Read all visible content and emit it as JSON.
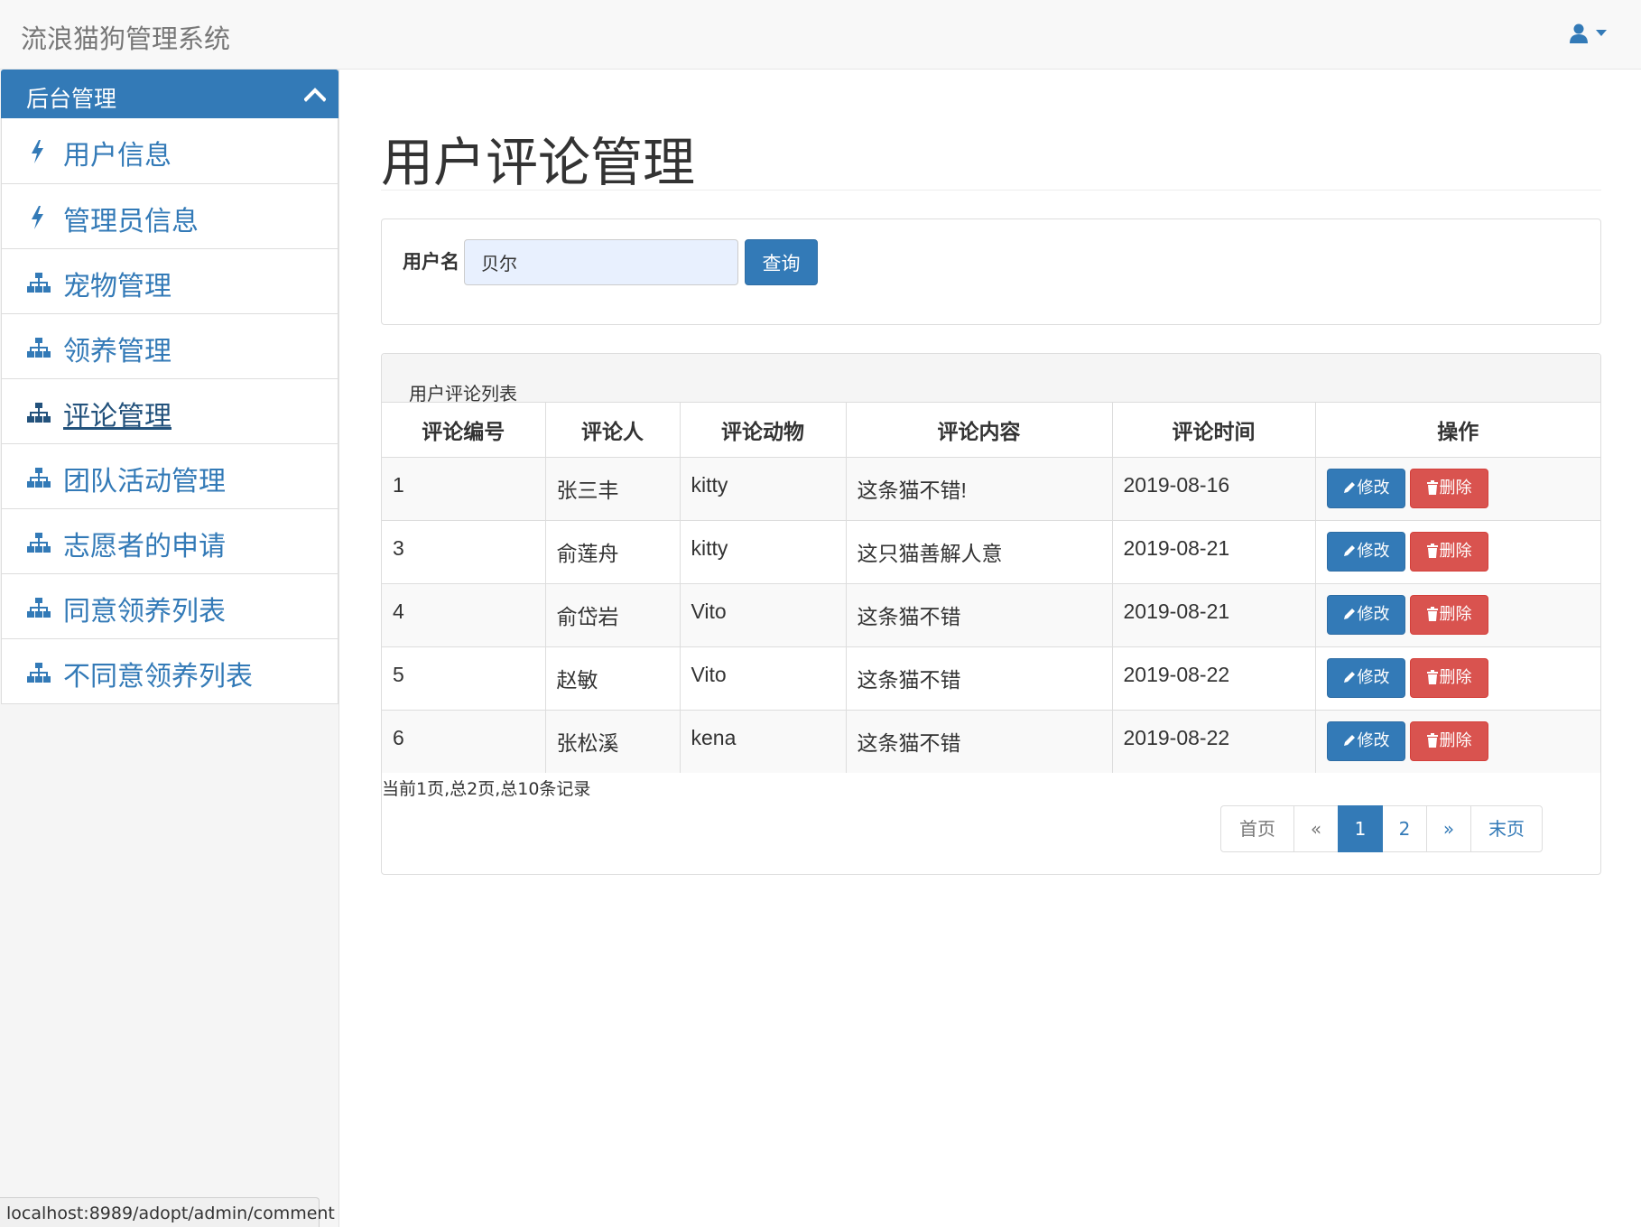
{
  "navbar": {
    "brand": "流浪猫狗管理系统",
    "user_icon": "user-icon",
    "caret_icon": "caret-down-icon"
  },
  "sidebar": {
    "header": "后台管理",
    "header_icon": "chevron-up-icon",
    "items": [
      {
        "label": "用户信息",
        "icon": "bolt-icon"
      },
      {
        "label": "管理员信息",
        "icon": "bolt-icon"
      },
      {
        "label": "宠物管理",
        "icon": "sitemap-icon"
      },
      {
        "label": "领养管理",
        "icon": "sitemap-icon"
      },
      {
        "label": "评论管理",
        "icon": "sitemap-icon",
        "active": true
      },
      {
        "label": "团队活动管理",
        "icon": "sitemap-icon"
      },
      {
        "label": "志愿者的申请",
        "icon": "sitemap-icon"
      },
      {
        "label": "同意领养列表",
        "icon": "sitemap-icon"
      },
      {
        "label": "不同意领养列表",
        "icon": "sitemap-icon"
      }
    ]
  },
  "main": {
    "title": "用户评论管理",
    "search": {
      "label": "用户名",
      "value": "贝尔",
      "button": "查询"
    },
    "list": {
      "heading": "用户评论列表",
      "columns": [
        "评论编号",
        "评论人",
        "评论动物",
        "评论内容",
        "评论时间",
        "操作"
      ],
      "rows": [
        {
          "id": "1",
          "user": "张三丰",
          "animal": "kitty",
          "content": "这条猫不错!",
          "time": "2019-08-16"
        },
        {
          "id": "3",
          "user": "俞莲舟",
          "animal": "kitty",
          "content": "这只猫善解人意",
          "time": "2019-08-21"
        },
        {
          "id": "4",
          "user": "俞岱岩",
          "animal": "Vito",
          "content": "这条猫不错",
          "time": "2019-08-21"
        },
        {
          "id": "5",
          "user": "赵敏",
          "animal": "Vito",
          "content": "这条猫不错",
          "time": "2019-08-22"
        },
        {
          "id": "6",
          "user": "张松溪",
          "animal": "kena",
          "content": "这条猫不错",
          "time": "2019-08-22"
        }
      ],
      "edit_label": "修改",
      "delete_label": "删除",
      "edit_icon": "pencil-icon",
      "delete_icon": "trash-icon"
    },
    "record_info": "当前1页,总2页,总10条记录",
    "pagination": {
      "first": "首页",
      "prev": "«",
      "pages": [
        "1",
        "2"
      ],
      "current": "1",
      "next": "»",
      "last": "末页"
    }
  },
  "status_bar": "localhost:8989/adopt/admin/comment",
  "colors": {
    "primary": "#337ab7",
    "danger": "#d9534f",
    "navbar_bg": "#f8f8f8",
    "sidebar_bg": "#f5f5f5"
  }
}
